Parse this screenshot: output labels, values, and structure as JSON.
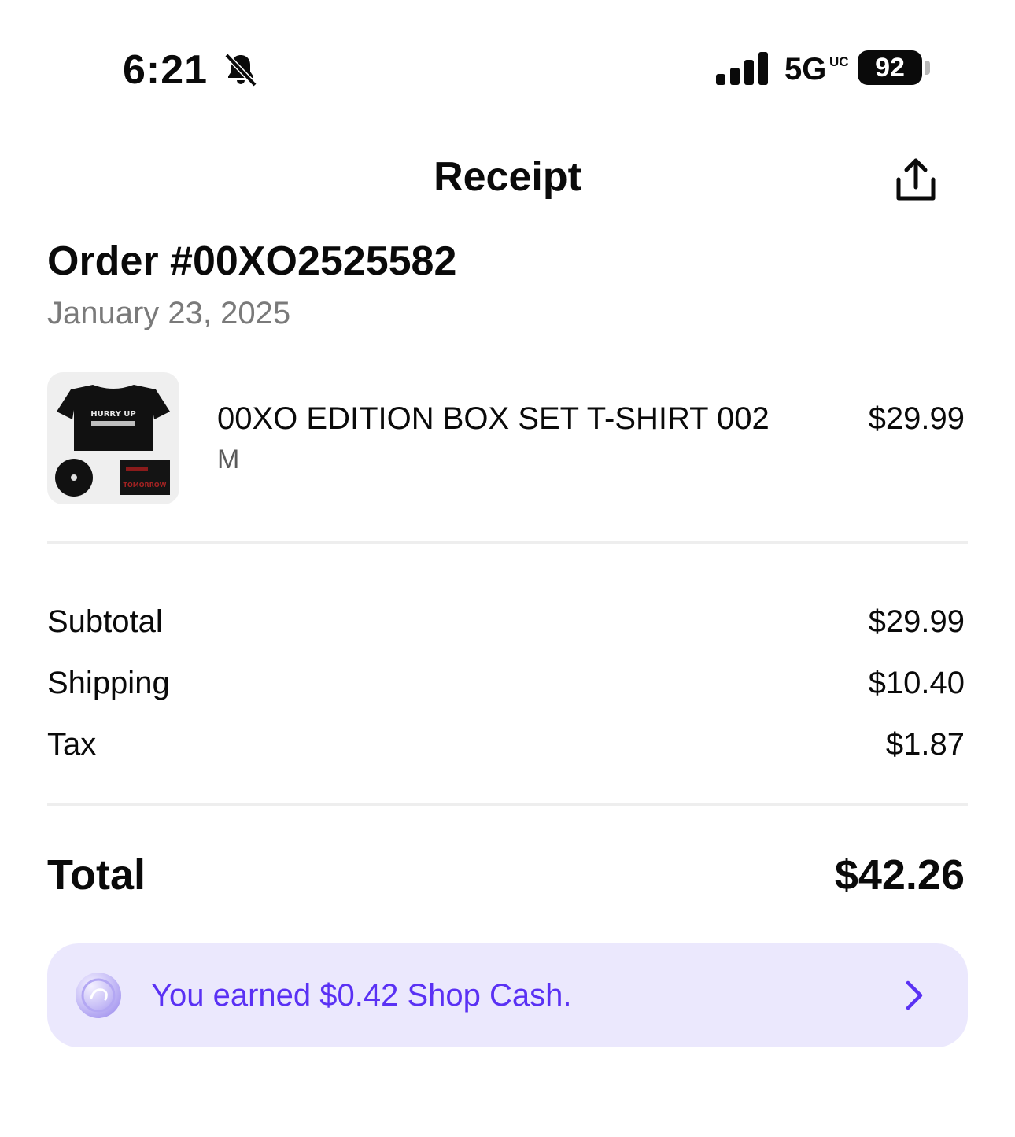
{
  "status_bar": {
    "time": "6:21",
    "network": "5G",
    "network_suffix": "UC",
    "battery": "92",
    "icons": [
      "bell-slash-icon",
      "cellular-signal-icon",
      "battery-icon"
    ]
  },
  "header": {
    "title": "Receipt",
    "share_icon": "share-icon"
  },
  "order": {
    "number_label": "Order #00XO2525582",
    "date": "January 23, 2025"
  },
  "items": [
    {
      "name": "00XO EDITION BOX SET T-SHIRT 002",
      "variant": "M",
      "price": "$29.99",
      "thumbnail_text": [
        "HURRY UP",
        "TOMORROW"
      ]
    }
  ],
  "summary": {
    "rows": [
      {
        "label": "Subtotal",
        "value": "$29.99"
      },
      {
        "label": "Shipping",
        "value": "$10.40"
      },
      {
        "label": "Tax",
        "value": "$1.87"
      }
    ],
    "total_label": "Total",
    "total_value": "$42.26"
  },
  "shop_cash": {
    "text": "You earned $0.42 Shop Cash.",
    "coin_icon": "shop-cash-coin-icon",
    "chevron_icon": "chevron-right-icon"
  },
  "colors": {
    "text": "#0a0a0a",
    "muted": "#7a7a7a",
    "divider": "#eeeeee",
    "banner_bg": "#ebe8fd",
    "accent": "#5a31f4"
  }
}
